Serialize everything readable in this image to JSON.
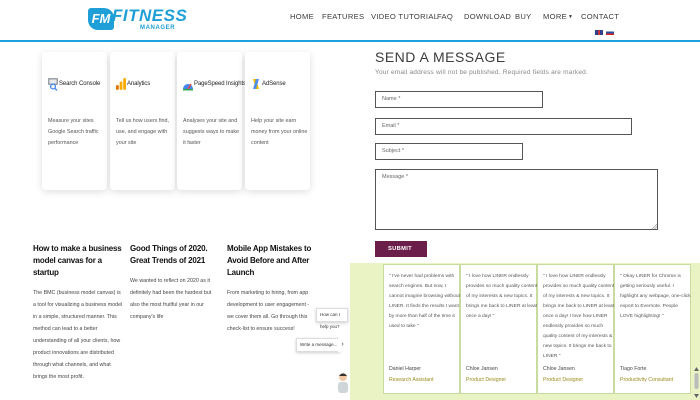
{
  "header": {
    "logo": {
      "mark": "FM",
      "brand": "FITNESS",
      "sub": "MANAGER"
    },
    "nav": [
      {
        "id": "home",
        "label": "HOME"
      },
      {
        "id": "features",
        "label": "FEATURES"
      },
      {
        "id": "video",
        "label": "VIDEO TUTORIAL"
      },
      {
        "id": "faq",
        "label": "FAQ"
      },
      {
        "id": "download",
        "label": "DOWNLOAD"
      },
      {
        "id": "buy",
        "label": "BUY"
      },
      {
        "id": "more",
        "label": "MORE"
      },
      {
        "id": "contact",
        "label": "CONTACT"
      }
    ]
  },
  "cards": [
    {
      "title": "Search Console",
      "icon": "search-console-icon",
      "desc": "Measure your sites Google Search traffic performance"
    },
    {
      "title": "Analytics",
      "icon": "analytics-icon",
      "desc": "Tell us how users find, use, and engage with your site"
    },
    {
      "title": "PageSpeed Insights",
      "icon": "pagespeed-icon",
      "desc": "Analyses your site and suggests ways to make it faster"
    },
    {
      "title": "AdSense",
      "icon": "adsense-icon",
      "desc": "Help your site earn money from your online content"
    }
  ],
  "posts": [
    {
      "title": "How to make a business model canvas for a startup",
      "text": "The BMC (business model canvas) is a tool for visualizing a business model in a simple, structured manner. This method can lead to a better understanding of all your clients, how product innovations are distributed through what channels, and what brings the most profit."
    },
    {
      "title": "Good Things of 2020. Great Trends of 2021",
      "text": "We wanted to reflect on 2020 as it definitely had been the hardest but also the most fruitful year in our company's life"
    },
    {
      "title": "Mobile App Mistakes to Avoid Before and After Launch",
      "text": "From marketing to hiring, from app development to user engagement - we cover them all. Go through this check-list to ensure success!"
    }
  ],
  "chat": {
    "hint": "How can I help you?",
    "placeholder": "Write a message..."
  },
  "form": {
    "title": "SEND A MESSAGE",
    "note": "Your email address will not be published. Required fields are marked.",
    "name": "Name *",
    "email": "Email *",
    "subject": "Subject *",
    "message": "Message *",
    "submit": "SUBMIT"
  },
  "testimonials": [
    {
      "quote": "\" I've never had problems with search engines. But now, I cannot imagine browsing without LINER. It finds the results I want by more than half of the time it used to take \"",
      "name": "Daniel Harper",
      "role": "Research Assistant"
    },
    {
      "quote": "\" I love how LINER endlessly provides so much quality content of my interests & new topics. It brings me back to LINER at least once a day! \"",
      "name": "Chloe Jansen",
      "role": "Product Designer"
    },
    {
      "quote": "\" I love how LINER endlessly provides so much quality content of my interests & new topics. It brings me back to LINER at least once a day! I love how LINER endlessly provides so much quality content of my interests & new topics. It brings me back to LINER \"",
      "name": "Chloe Jansen",
      "role": "Product Designer"
    },
    {
      "quote": "\" Okay LINER for Chrome is getting seriously useful. I highlight any webpage, one-click export to Evernote. People LOVE highlighting! \"",
      "name": "Tiago Forte",
      "role": "Productivity Consultant"
    }
  ],
  "colors": {
    "brand": "#1e9fd8",
    "submit": "#6b1e4a",
    "testimonial_bg": "#eaf3c4",
    "role": "#9a8a1a"
  }
}
